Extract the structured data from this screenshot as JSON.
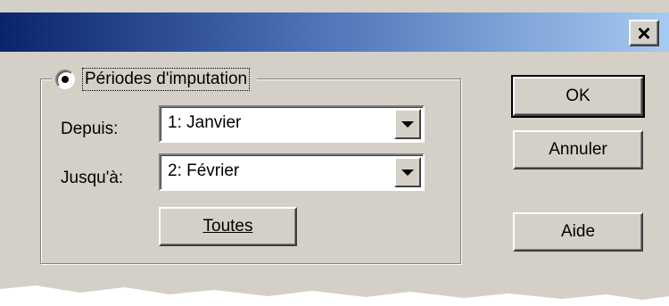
{
  "titlebar": {
    "close_glyph": "×"
  },
  "group": {
    "radio_checked": true,
    "label": "Périodes d'imputation"
  },
  "fields": {
    "depuis_label": "Depuis:",
    "depuis_value": "1: Janvier",
    "jusqua_label": "Jusqu'à:",
    "jusqua_value": "2: Février"
  },
  "buttons": {
    "toutes": "Toutes",
    "ok": "OK",
    "annuler": "Annuler",
    "aide": "Aide"
  }
}
